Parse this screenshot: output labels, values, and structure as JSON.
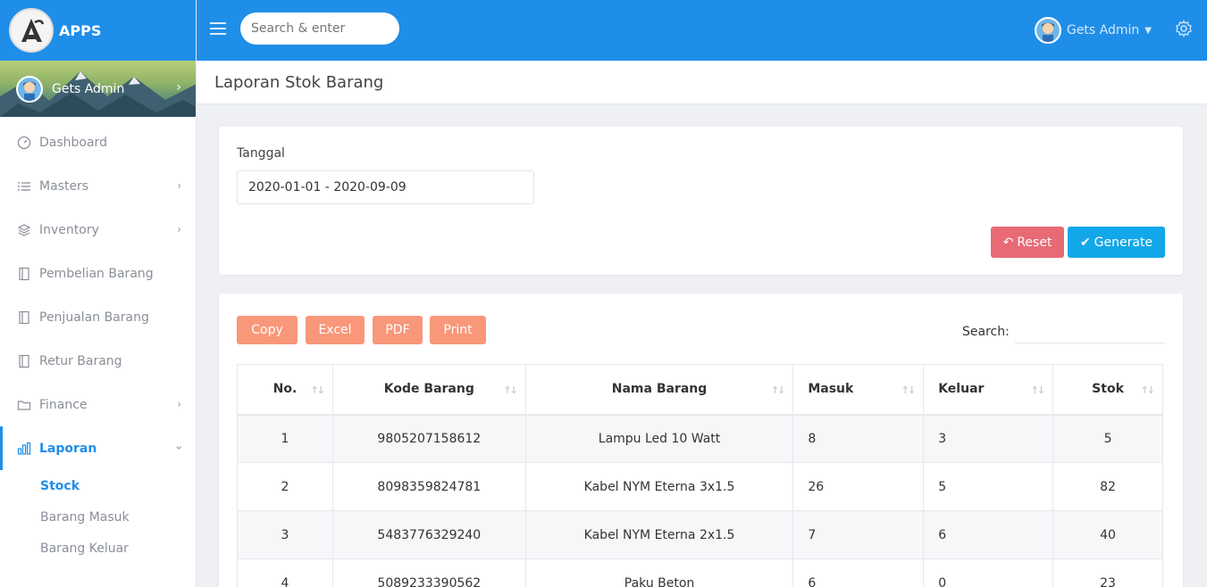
{
  "brand": {
    "name": "APPS"
  },
  "sidebar": {
    "user_name": "Gets Admin",
    "items": [
      {
        "label": "Dashboard",
        "icon": "gauge-icon",
        "has_arrow": false
      },
      {
        "label": "Masters",
        "icon": "list-icon",
        "has_arrow": true
      },
      {
        "label": "Inventory",
        "icon": "layers-icon",
        "has_arrow": true
      },
      {
        "label": "Pembelian Barang",
        "icon": "notebook-icon",
        "has_arrow": false
      },
      {
        "label": "Penjualan Barang",
        "icon": "notebook-icon",
        "has_arrow": false
      },
      {
        "label": "Retur Barang",
        "icon": "notebook-icon",
        "has_arrow": false
      },
      {
        "label": "Finance",
        "icon": "folder-icon",
        "has_arrow": true
      },
      {
        "label": "Laporan",
        "icon": "bar-chart-icon",
        "has_arrow": true,
        "active": true
      }
    ],
    "sub_items": [
      {
        "label": "Stock",
        "active": true
      },
      {
        "label": "Barang Masuk"
      },
      {
        "label": "Barang Keluar"
      }
    ]
  },
  "topbar": {
    "search_placeholder": "Search & enter",
    "user_name": "Gets Admin"
  },
  "page": {
    "title": "Laporan Stok Barang"
  },
  "filter": {
    "date_label": "Tanggal",
    "date_value": "2020-01-01 - 2020-09-09",
    "reset_label": "Reset",
    "generate_label": "Generate"
  },
  "table": {
    "export_buttons": [
      "Copy",
      "Excel",
      "PDF",
      "Print"
    ],
    "search_label": "Search:",
    "columns": [
      "No.",
      "Kode Barang",
      "Nama Barang",
      "Masuk",
      "Keluar",
      "Stok"
    ],
    "rows": [
      {
        "no": "1",
        "kode": "9805207158612",
        "nama": "Lampu Led 10 Watt",
        "masuk": "8",
        "keluar": "3",
        "stok": "5"
      },
      {
        "no": "2",
        "kode": "8098359824781",
        "nama": "Kabel NYM Eterna 3x1.5",
        "masuk": "26",
        "keluar": "5",
        "stok": "82"
      },
      {
        "no": "3",
        "kode": "5483776329240",
        "nama": "Kabel NYM Eterna 2x1.5",
        "masuk": "7",
        "keluar": "6",
        "stok": "40"
      },
      {
        "no": "4",
        "kode": "5089233390562",
        "nama": "Paku Beton",
        "masuk": "6",
        "keluar": "0",
        "stok": "23"
      }
    ]
  },
  "colors": {
    "primary": "#1f8ee8",
    "reset": "#e76a75",
    "generate": "#12a7e8",
    "export": "#f9977a",
    "code_link": "#f38a6c"
  }
}
